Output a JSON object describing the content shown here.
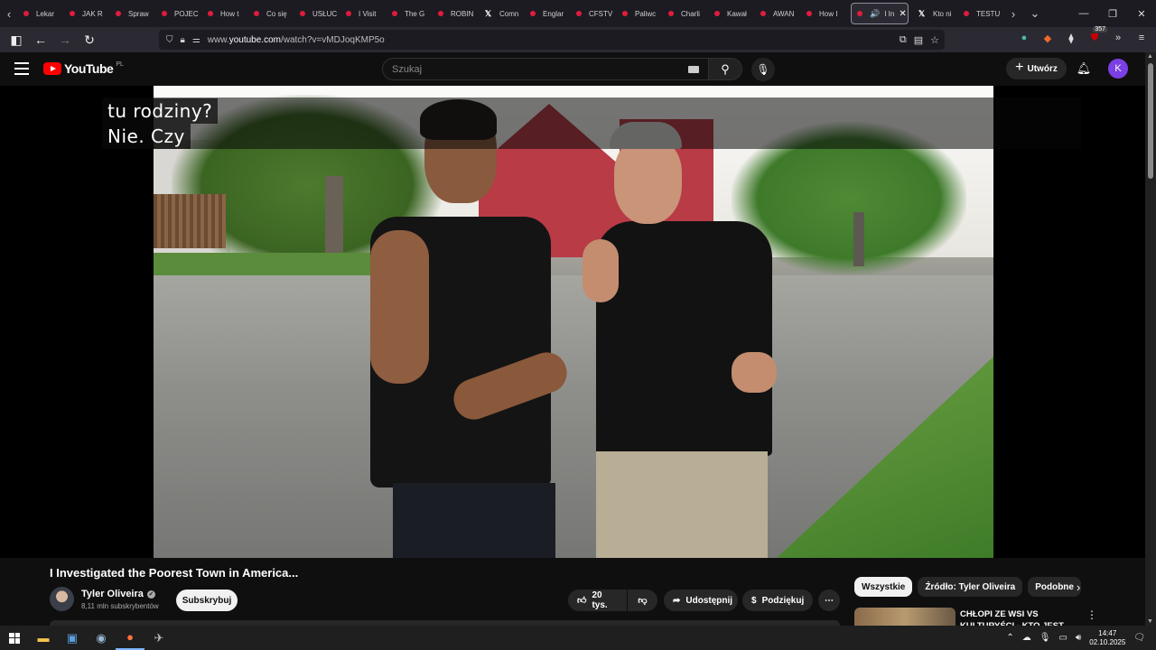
{
  "browser": {
    "tabs": [
      {
        "label": "Lekar",
        "icon": "youtube-icon"
      },
      {
        "label": "JAK R",
        "icon": "youtube-icon"
      },
      {
        "label": "Spraw",
        "icon": "youtube-icon"
      },
      {
        "label": "POJEC",
        "icon": "youtube-icon"
      },
      {
        "label": "How t",
        "icon": "youtube-icon"
      },
      {
        "label": "Co się",
        "icon": "youtube-icon"
      },
      {
        "label": "USŁUC",
        "icon": "youtube-icon"
      },
      {
        "label": "I Visit",
        "icon": "youtube-icon"
      },
      {
        "label": "The G",
        "icon": "youtube-icon"
      },
      {
        "label": "ROBIN",
        "icon": "youtube-icon"
      },
      {
        "label": "Comn",
        "icon": "x-icon"
      },
      {
        "label": "Englar",
        "icon": "youtube-icon"
      },
      {
        "label": "CFSTV",
        "icon": "youtube-icon"
      },
      {
        "label": "Paliwc",
        "icon": "youtube-icon"
      },
      {
        "label": "Charli",
        "icon": "youtube-icon"
      },
      {
        "label": "Kawał",
        "icon": "youtube-icon"
      },
      {
        "label": "AWAN",
        "icon": "youtube-icon"
      },
      {
        "label": "How I",
        "icon": "youtube-icon"
      }
    ],
    "active_tab": {
      "label": "I In",
      "icon": "youtube-icon"
    },
    "tabs_after": [
      {
        "label": "Kto ni",
        "icon": "x-icon"
      },
      {
        "label": "TESTU",
        "icon": "youtube-icon"
      }
    ],
    "url_prefix": "www.",
    "url_host": "youtube.com",
    "url_path": "/watch?v=vMDJoqKMP5o",
    "extensions_badge": "357"
  },
  "youtube": {
    "logo_text": "YouTube",
    "country_code": "PL",
    "search_placeholder": "Szukaj",
    "create_label": "Utwórz",
    "avatar_letter": "K"
  },
  "video": {
    "subtitle_line1": "tu rodziny?",
    "subtitle_line2": "Nie. Czy",
    "title": "I Investigated the Poorest Town in America...",
    "channel_name": "Tyler Oliveira",
    "channel_subs": "8,11 mln subskrybentów",
    "subscribe_label": "Subskrybuj",
    "likes": "20 tys.",
    "share_label": "Udostępnij",
    "thanks_label": "Podziękuj"
  },
  "sidebar": {
    "chips": [
      "Wszystkie",
      "Źródło: Tyler Oliveira",
      "Podobne"
    ],
    "rec_title": "CHŁOPI ZE WSI VS KULTURYŚCI - KTO JEST"
  },
  "taskbar": {
    "time": "14:47",
    "date": "02.10.2025"
  }
}
